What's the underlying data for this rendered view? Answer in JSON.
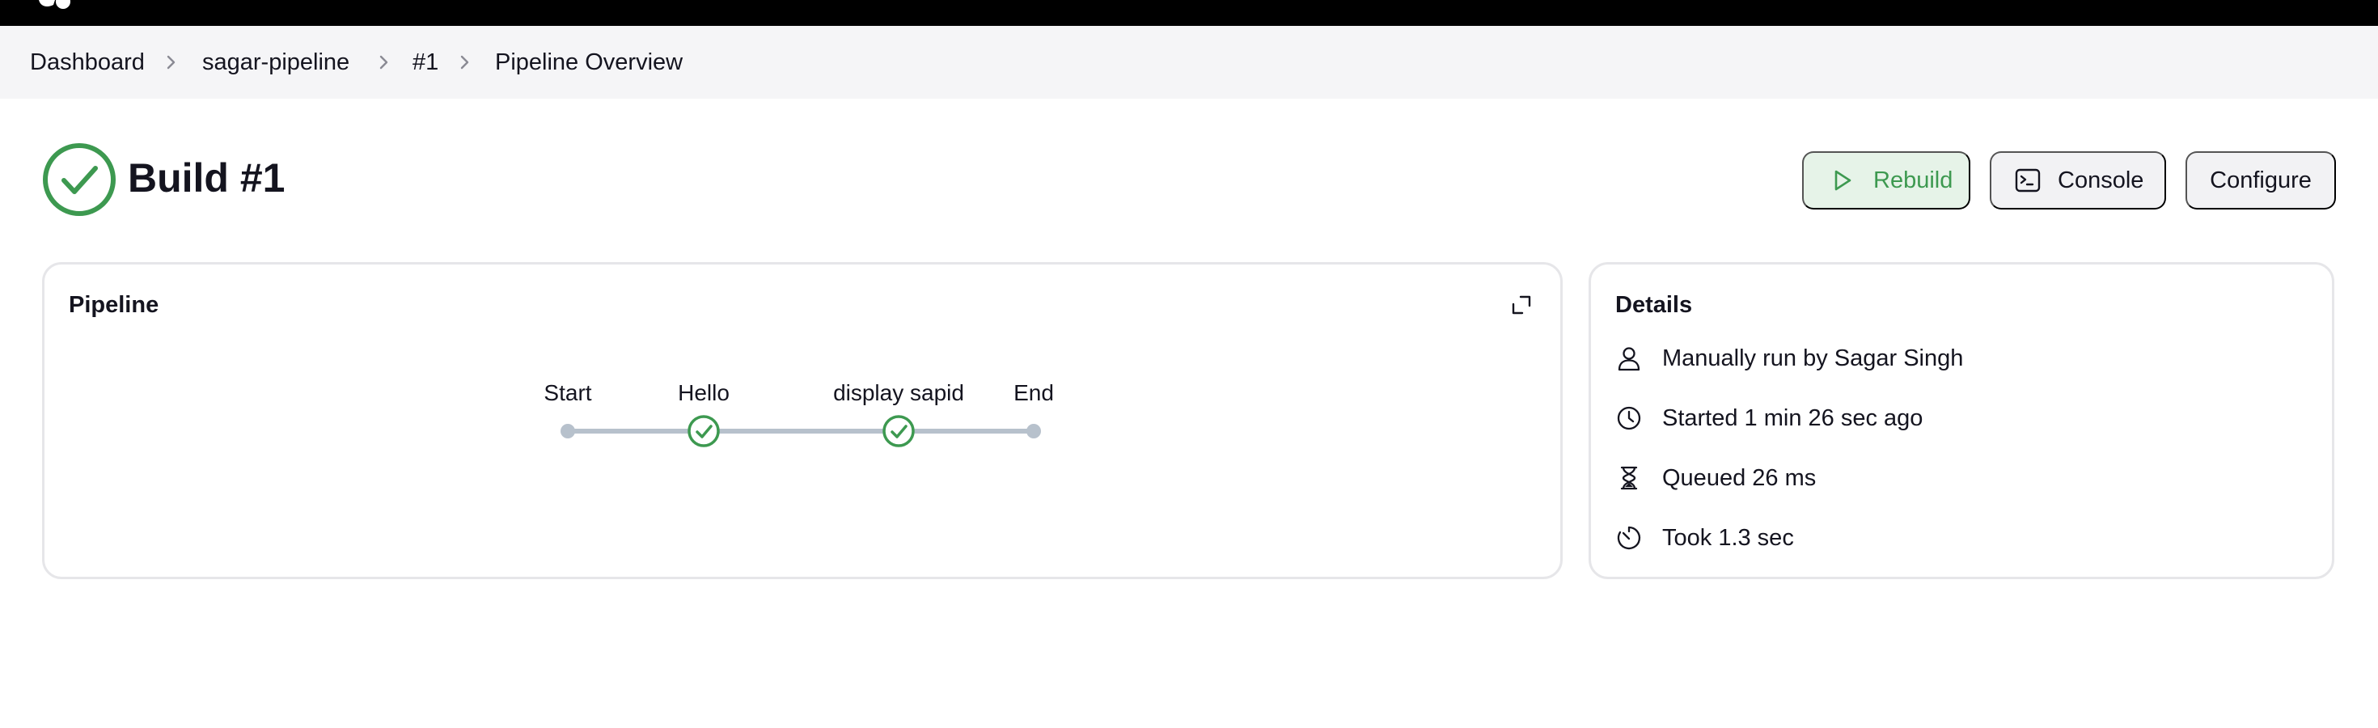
{
  "breadcrumb": {
    "items": [
      "Dashboard",
      "sagar-pipeline",
      "#1",
      "Pipeline Overview"
    ]
  },
  "build": {
    "title": "Build #1",
    "status": "success",
    "status_color": "#3d9950"
  },
  "actions": {
    "rebuild_label": "Rebuild",
    "console_label": "Console",
    "configure_label": "Configure"
  },
  "pipeline_card": {
    "title": "Pipeline",
    "stages": [
      {
        "name": "Start",
        "status": "node"
      },
      {
        "name": "Hello",
        "status": "success"
      },
      {
        "name": "display sapid",
        "status": "success"
      },
      {
        "name": "End",
        "status": "node"
      }
    ],
    "colors": {
      "edge": "#b7c1cc",
      "success": "#3d9950",
      "node": "#b7c1cc"
    }
  },
  "details_card": {
    "title": "Details",
    "rows": [
      {
        "icon": "person-icon",
        "text": "Manually run by Sagar Singh"
      },
      {
        "icon": "clock-icon",
        "text": "Started 1 min 26 sec ago"
      },
      {
        "icon": "hourglass-icon",
        "text": "Queued 26 ms"
      },
      {
        "icon": "timer-icon",
        "text": "Took 1.3 sec"
      }
    ]
  }
}
